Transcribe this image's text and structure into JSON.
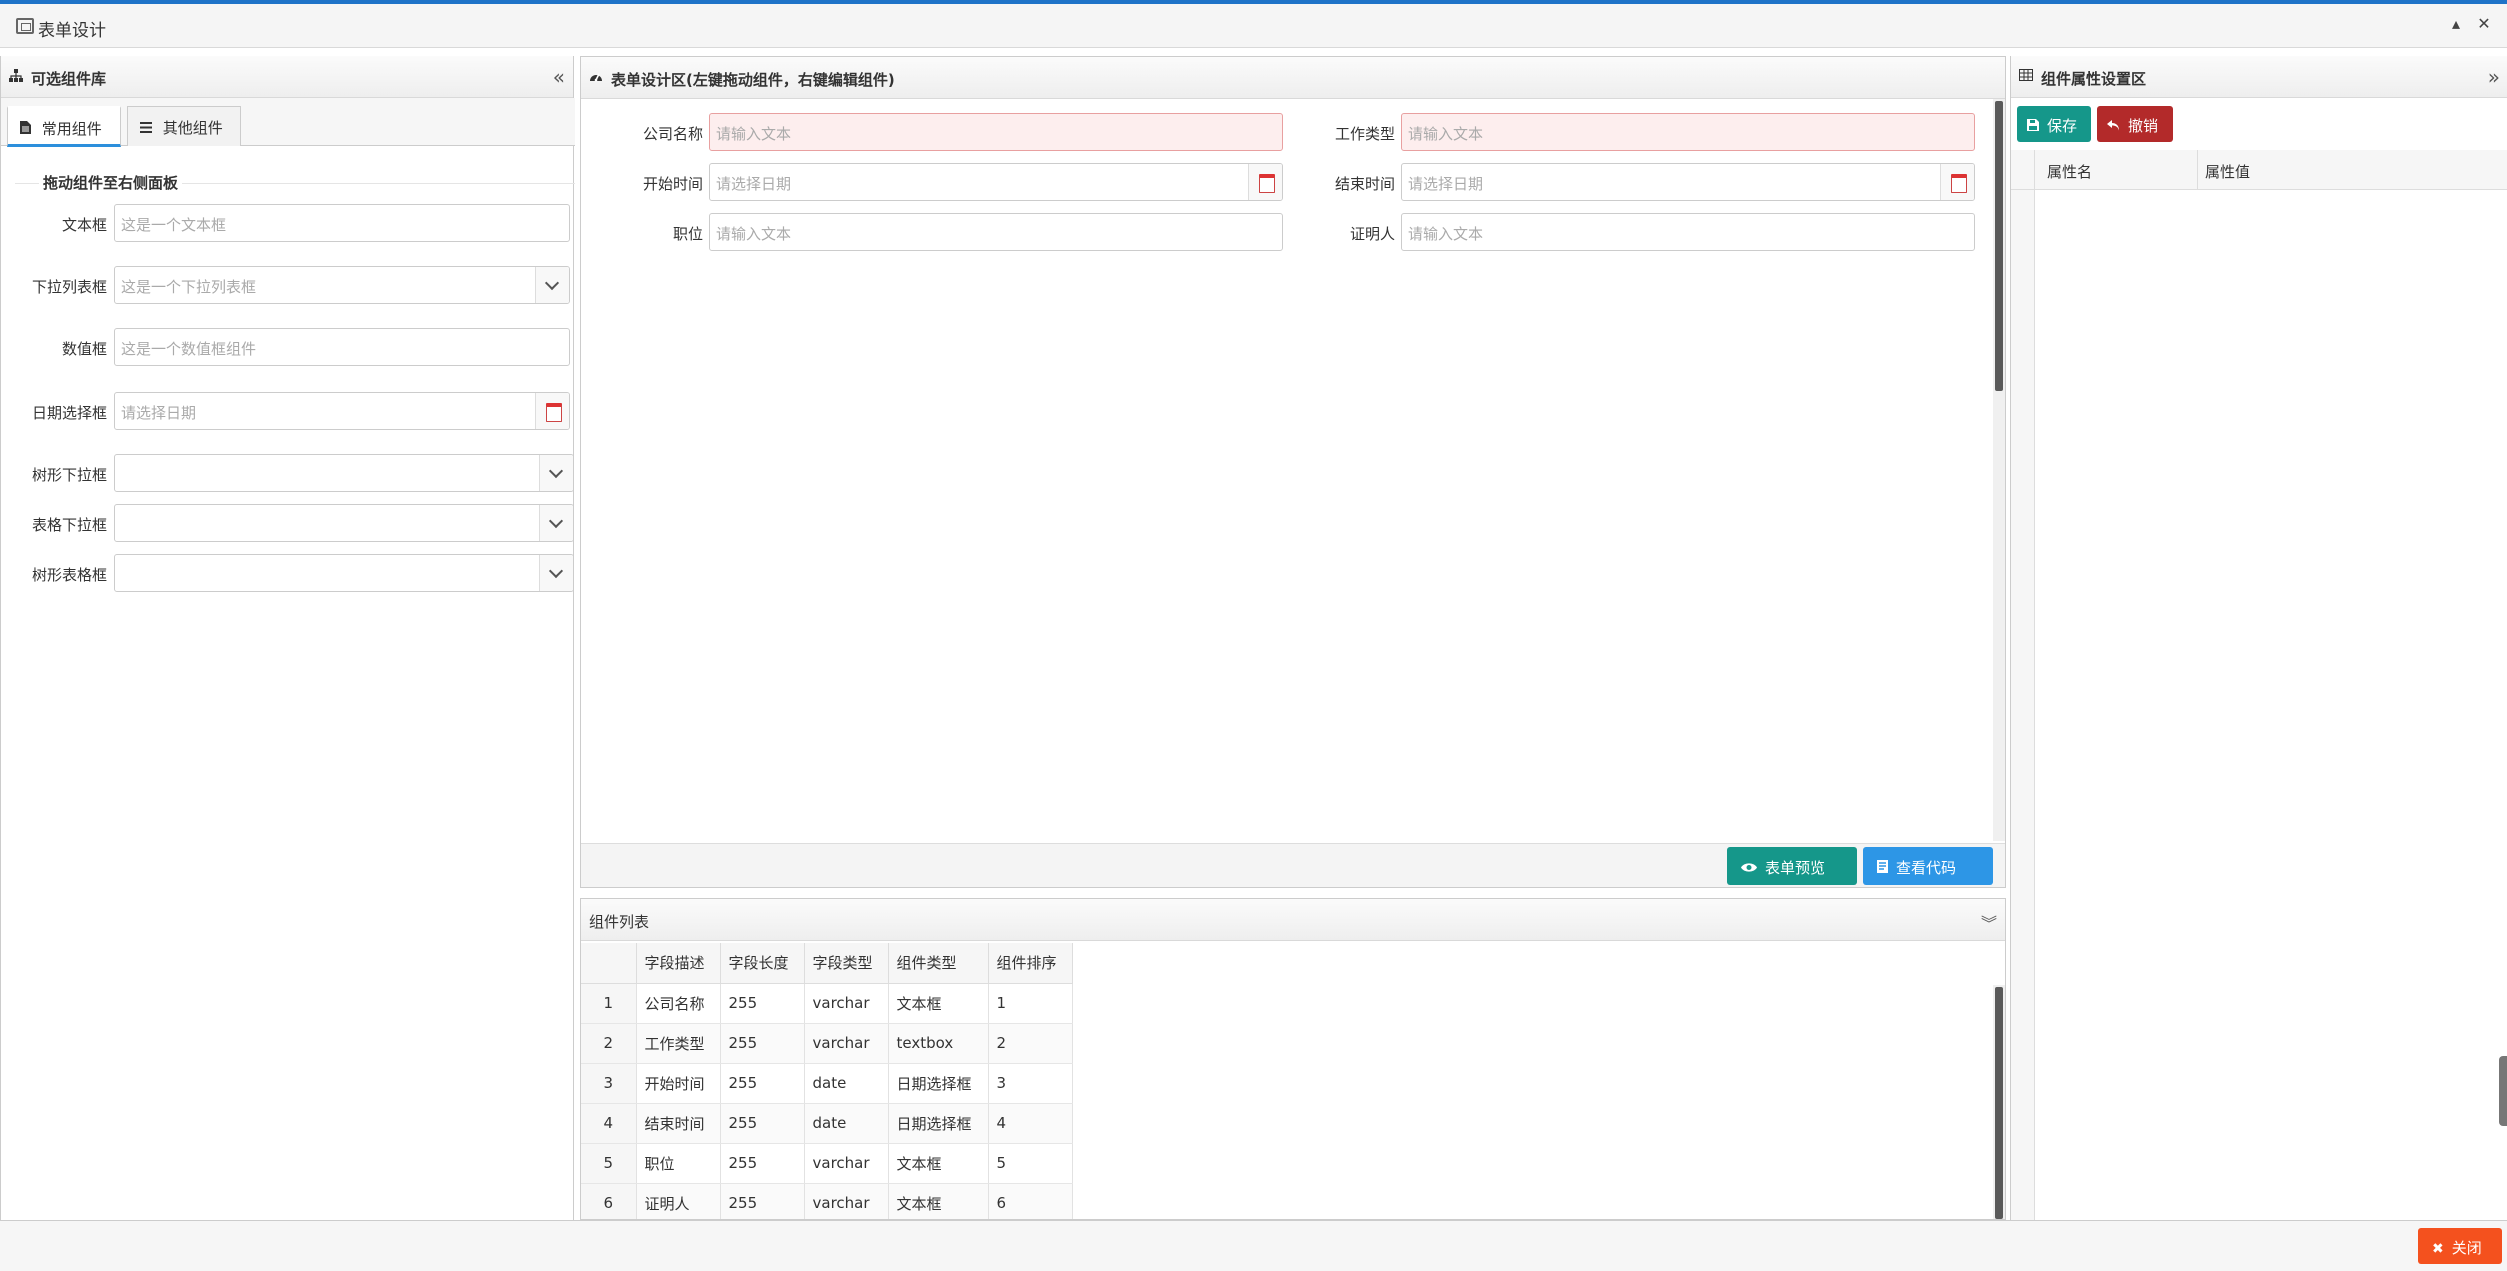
{
  "window": {
    "title": "表单设计",
    "minimize_glyph": "▴",
    "close_glyph": "✕"
  },
  "left_panel": {
    "title": "可选组件库",
    "collapse_glyph": "«",
    "tabs": [
      {
        "label": "常用组件",
        "icon": "file-icon",
        "active": true
      },
      {
        "label": "其他组件",
        "icon": "list-icon",
        "active": false
      }
    ],
    "section_title": "拖动组件至右侧面板",
    "fields": [
      {
        "label": "文本框",
        "placeholder": "这是一个文本框",
        "kind": "text"
      },
      {
        "label": "下拉列表框",
        "placeholder": "这是一个下拉列表框",
        "kind": "select"
      },
      {
        "label": "数值框",
        "placeholder": "这是一个数值框组件",
        "kind": "text"
      },
      {
        "label": "日期选择框",
        "placeholder": "请选择日期",
        "kind": "date"
      },
      {
        "label": "树形下拉框",
        "placeholder": "",
        "kind": "select"
      },
      {
        "label": "表格下拉框",
        "placeholder": "",
        "kind": "select"
      },
      {
        "label": "树形表格框",
        "placeholder": "",
        "kind": "select"
      }
    ]
  },
  "design_panel": {
    "title": "表单设计区(左键拖动组件，右键编辑组件)",
    "fields": [
      {
        "label": "公司名称",
        "placeholder": "请输入文本",
        "kind": "text",
        "required": true
      },
      {
        "label": "工作类型",
        "placeholder": "请输入文本",
        "kind": "text",
        "required": true
      },
      {
        "label": "开始时间",
        "placeholder": "请选择日期",
        "kind": "date",
        "required": false
      },
      {
        "label": "结束时间",
        "placeholder": "请选择日期",
        "kind": "date",
        "required": false
      },
      {
        "label": "职位",
        "placeholder": "请输入文本",
        "kind": "text",
        "required": false
      },
      {
        "label": "证明人",
        "placeholder": "请输入文本",
        "kind": "text",
        "required": false
      }
    ],
    "preview_label": "表单预览",
    "code_label": "查看代码",
    "preview_color": "#15978a",
    "code_color": "#2d96e6"
  },
  "component_list": {
    "title": "组件列表",
    "collapse_glyph": "︾",
    "columns": [
      "字段描述",
      "字段长度",
      "字段类型",
      "组件类型",
      "组件排序"
    ],
    "rows": [
      {
        "n": "1",
        "cells": [
          "公司名称",
          "255",
          "varchar",
          "文本框",
          "1"
        ]
      },
      {
        "n": "2",
        "cells": [
          "工作类型",
          "255",
          "varchar",
          "textbox",
          "2"
        ]
      },
      {
        "n": "3",
        "cells": [
          "开始时间",
          "255",
          "date",
          "日期选择框",
          "3"
        ]
      },
      {
        "n": "4",
        "cells": [
          "结束时间",
          "255",
          "date",
          "日期选择框",
          "4"
        ]
      },
      {
        "n": "5",
        "cells": [
          "职位",
          "255",
          "varchar",
          "文本框",
          "5"
        ]
      },
      {
        "n": "6",
        "cells": [
          "证明人",
          "255",
          "varchar",
          "文本框",
          "6"
        ]
      }
    ]
  },
  "property_panel": {
    "title": "组件属性设置区",
    "expand_glyph": "»",
    "save_label": "保存",
    "undo_label": "撤销",
    "save_color": "#15978a",
    "undo_color": "#b32a2a",
    "col_name": "属性名",
    "col_value": "属性值"
  },
  "footer": {
    "close_label": "关闭",
    "close_color": "#f4511e"
  }
}
